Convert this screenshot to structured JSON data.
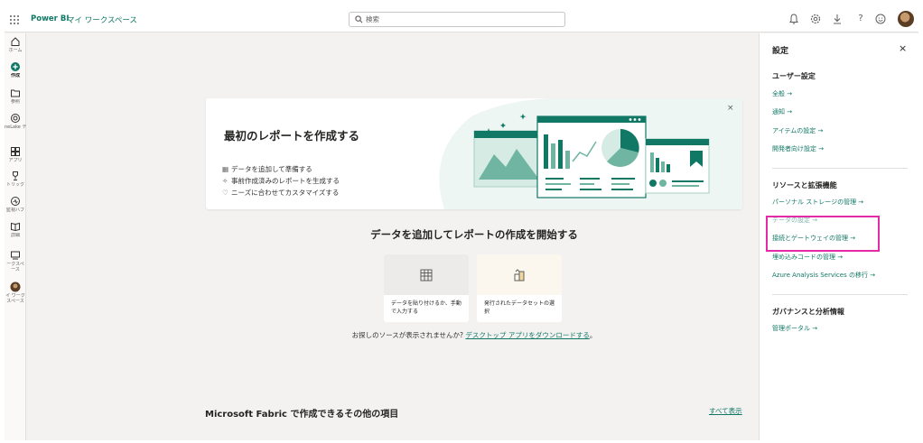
{
  "topbar": {
    "brand": "Power BI",
    "workspace": "マイ ワークスペース",
    "search_placeholder": "検索",
    "icons": [
      "waffle-icon",
      "bell-icon",
      "gear-icon",
      "download-icon",
      "help-icon",
      "feedback-icon"
    ]
  },
  "leftnav": {
    "items": [
      {
        "label": "ホーム",
        "icon": "home-icon"
      },
      {
        "label": "作成",
        "icon": "plus-icon"
      },
      {
        "label": "参照",
        "icon": "folder-icon"
      },
      {
        "label": "neLake データ ハブ",
        "icon": "onelake-icon"
      },
      {
        "label": "アプリ",
        "icon": "apps-icon"
      },
      {
        "label": "トリック",
        "icon": "trophy-icon"
      },
      {
        "label": "監視ハブ",
        "icon": "monitor-icon"
      },
      {
        "label": "詳細",
        "icon": "book-icon"
      },
      {
        "label": "ークスペース",
        "icon": "workspace-icon"
      },
      {
        "label": "イ ワークスペース",
        "icon": "my-workspace-icon"
      }
    ]
  },
  "main": {
    "card": {
      "title": "最初のレポートを作成する",
      "bullets": [
        "データを追加して準備する",
        "事前作成済みのレポートを生成する",
        "ニーズに合わせてカスタマイズする"
      ],
      "close": "×"
    },
    "cta_title": "データを追加してレポートの作成を開始する",
    "tiles": [
      {
        "label": "データを貼り付けるか、手動で入力する",
        "icon": "table-icon"
      },
      {
        "label": "発行されたデータセットの選択",
        "icon": "dataset-icon"
      }
    ],
    "hint_prefix": "お探しのソースが表示されませんか?",
    "hint_link": "デスクトップ アプリをダウンロードする",
    "hint_suffix": "。",
    "fabric_title": "Microsoft Fabric で作成できるその他の項目",
    "see_all": "すべて表示"
  },
  "panel": {
    "title": "設定",
    "close": "×",
    "sections": [
      {
        "title": "ユーザー設定",
        "links": [
          "全般 →",
          "通知 →",
          "アイテムの設定 →",
          "開発者向け設定 →"
        ]
      },
      {
        "title": "リソースと拡張機能",
        "links": [
          "パーソナル ストレージの管理 →",
          "データの設定 →",
          "接続とゲートウェイの管理 →",
          "埋め込みコードの管理 →",
          "Azure Analysis Services の移行 →"
        ]
      },
      {
        "title": "ガバナンスと分析情報",
        "links": [
          "管理ポータル →"
        ]
      }
    ]
  },
  "colors": {
    "accent": "#117865",
    "highlight": "#e42aa6",
    "background": "#f3f2f1"
  }
}
